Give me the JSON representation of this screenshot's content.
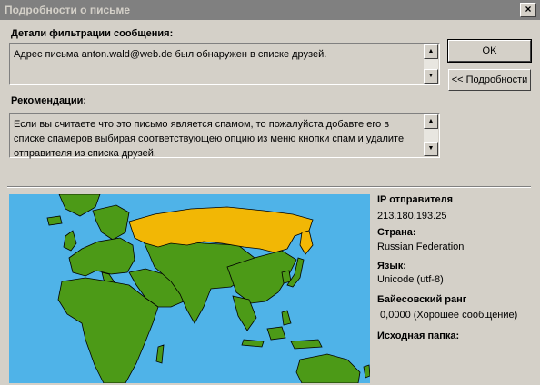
{
  "window": {
    "title": "Подробности о письме",
    "close": "×"
  },
  "filter": {
    "label": "Детали фильтрации сообщения:",
    "text": "Адрес письма anton.wald@web.de был обнаружен в списке друзей."
  },
  "recommend": {
    "label": "Рекомендации:",
    "text": "Если вы считаете что это письмо является спамом, то пожалуйста добавте его в списке спамеров выбирая соответствующею опцию из меню кнопки спам и удалите отправителя из списка друзей."
  },
  "buttons": {
    "ok": "OK",
    "details": "<< Подробности"
  },
  "sender": {
    "ip_label": "IP отправителя",
    "ip": "213.180.193.25",
    "country_label": "Страна:",
    "country": "Russian Federation",
    "lang_label": "Язык:",
    "lang": "Unicode (utf-8)",
    "bayes_label": "Байесовский ранг",
    "bayes": " 0,0000 (Хорошее сообщение)",
    "folder_label": "Исходная папка:"
  },
  "colors": {
    "sea": "#4fb3e8",
    "land": "#4c9a17",
    "highlight": "#f2b705"
  }
}
